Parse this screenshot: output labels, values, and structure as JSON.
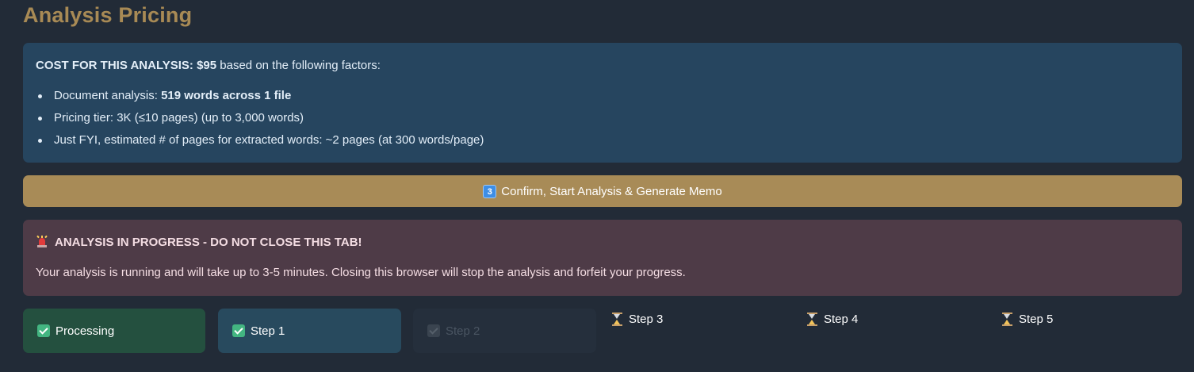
{
  "page": {
    "title": "Analysis Pricing"
  },
  "cost_box": {
    "cost_label": "COST FOR THIS ANALYSIS:",
    "cost_value": "$95",
    "cost_suffix": " based on the following factors:",
    "factors": [
      {
        "label": "Document analysis: ",
        "value": "519 words across 1 file"
      },
      {
        "label": "Pricing tier: 3K (≤10 pages) (up to 3,000 words)",
        "value": ""
      },
      {
        "label": "Just FYI, estimated # of pages for extracted words: ~2 pages (at 300 words/page)",
        "value": ""
      }
    ]
  },
  "confirm_button": {
    "keycap": "3",
    "label": "Confirm, Start Analysis & Generate Memo"
  },
  "warning": {
    "title": "ANALYSIS IN PROGRESS - DO NOT CLOSE THIS TAB!",
    "message": "Your analysis is running and will take up to 3-5 minutes. Closing this browser will stop the analysis and forfeit your progress."
  },
  "steps": [
    {
      "label": "Processing",
      "status": "complete"
    },
    {
      "label": "Step 1",
      "status": "complete"
    },
    {
      "label": "Step 2",
      "status": "active"
    },
    {
      "label": "Step 3",
      "status": "pending"
    },
    {
      "label": "Step 4",
      "status": "pending"
    },
    {
      "label": "Step 5",
      "status": "pending"
    }
  ],
  "colors": {
    "background": "#222b37",
    "accent": "#a88b57",
    "info_box": "#26455f",
    "warning_box": "#4e3b47",
    "complete_step": "#24503f",
    "step_1": "#284a5e"
  }
}
